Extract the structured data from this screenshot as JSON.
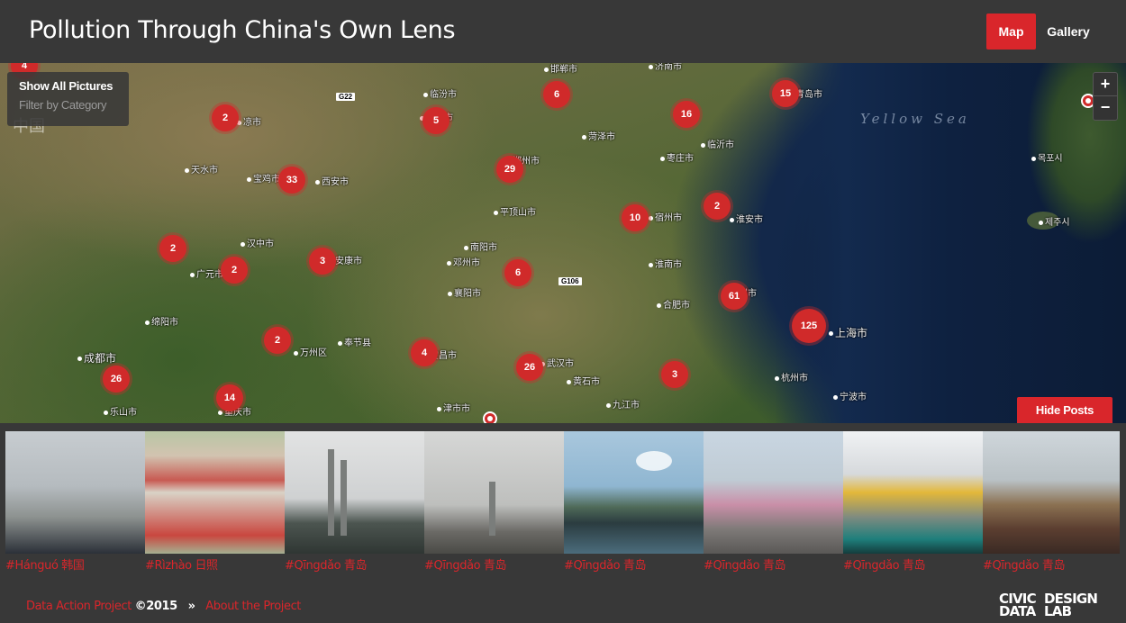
{
  "header": {
    "title": "Pollution Through China's Own Lens",
    "nav_map": "Map",
    "nav_gallery": "Gallery"
  },
  "map": {
    "filter_show_all": "Show All Pictures",
    "filter_by_category": "Filter by Category",
    "zoom_in": "+",
    "zoom_out": "−",
    "hide_posts": "Hide Posts",
    "sea_label": "Yellow Sea",
    "country_label": "中国",
    "roads": [
      "G22",
      "G106"
    ],
    "cities": [
      "邯郸市",
      "济南市",
      "临汾市",
      "青岛市",
      "凉市",
      "运城市",
      "菏泽市",
      "临沂市",
      "天水市",
      "宝鸡市",
      "西安市",
      "郑州市",
      "枣庄市",
      "平顶山市",
      "宿州市",
      "淮安市",
      "汉中市",
      "安康市",
      "南阳市",
      "邓州市",
      "淮南市",
      "广元市",
      "襄阳市",
      "合肥市",
      "扬州市",
      "绵阳市",
      "上海市",
      "万州区",
      "奉节县",
      "宜昌市",
      "成都市",
      "武汉市",
      "黄石市",
      "杭州市",
      "乐山市",
      "重庆市",
      "津市市",
      "九江市",
      "宁波市",
      "目포시",
      "제주시",
      "목포시",
      "고"
    ],
    "clusters": [
      "4",
      "2",
      "6",
      "5",
      "16",
      "15",
      "33",
      "29",
      "10",
      "2",
      "2",
      "2",
      "3",
      "6",
      "61",
      "125",
      "2",
      "4",
      "26",
      "3",
      "26",
      "14"
    ]
  },
  "gallery": {
    "posts": [
      {
        "tag": "#Hánguó 韩国"
      },
      {
        "tag": "#Rìzhào 日照"
      },
      {
        "tag": "#Qīngdǎo 青岛"
      },
      {
        "tag": "#Qīngdǎo 青岛"
      },
      {
        "tag": "#Qīngdǎo 青岛"
      },
      {
        "tag": "#Qīngdǎo 青岛"
      },
      {
        "tag": "#Qīngdǎo 青岛"
      },
      {
        "tag": "#Qīngdǎo 青岛"
      }
    ]
  },
  "footer": {
    "project_link": "Data Action Project",
    "copyright": "©2015",
    "separator": "»",
    "about_link": "About the Project",
    "logo_line1a": "CIVIC",
    "logo_line1b": "DESIGN",
    "logo_line2a": "DATA",
    "logo_line2b": "LAB"
  },
  "colors": {
    "accent": "#d9262b",
    "chrome": "#383838",
    "cluster": "#d02a2a"
  }
}
